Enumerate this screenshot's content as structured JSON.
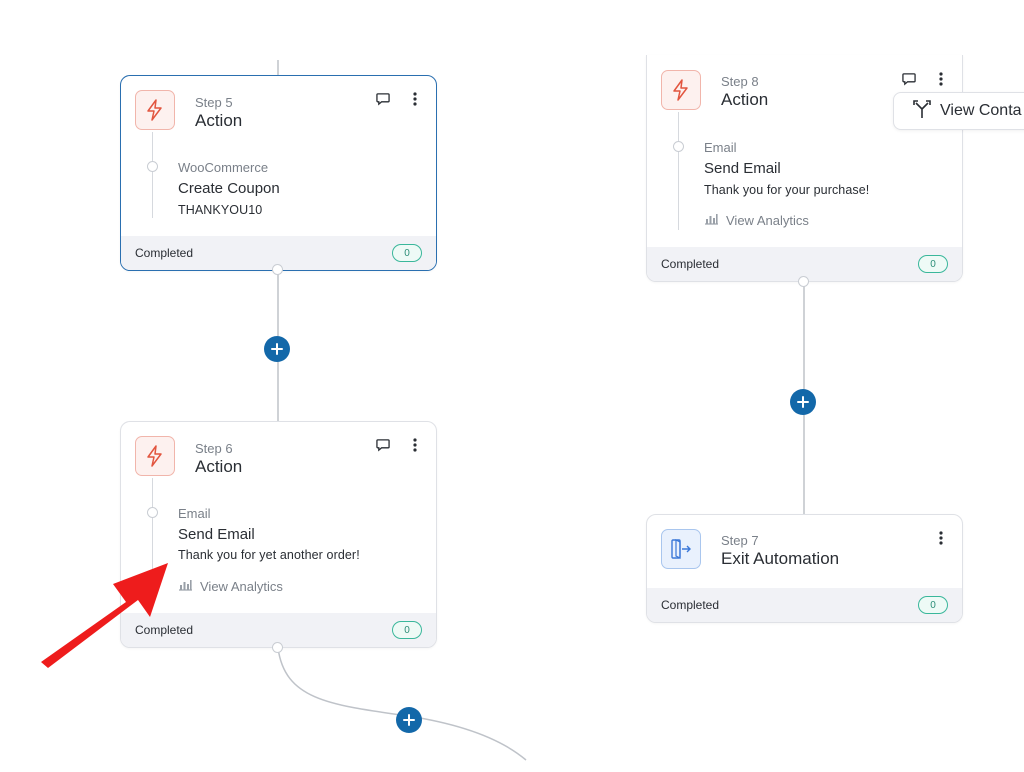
{
  "cards": {
    "step5": {
      "step_label": "Step 5",
      "title": "Action",
      "sub_type": "WooCommerce",
      "sub_title": "Create Coupon",
      "sub_desc": "THANKYOU10",
      "status": "Completed",
      "count": "0"
    },
    "step6": {
      "step_label": "Step 6",
      "title": "Action",
      "sub_type": "Email",
      "sub_title": "Send Email",
      "sub_desc": "Thank you for yet another order!",
      "analytics_label": "View Analytics",
      "status": "Completed",
      "count": "0"
    },
    "step8": {
      "step_label": "Step 8",
      "title": "Action",
      "sub_type": "Email",
      "sub_title": "Send Email",
      "sub_desc": "Thank you for your purchase!",
      "analytics_label": "View Analytics",
      "status": "Completed",
      "count": "0"
    },
    "step7": {
      "step_label": "Step 7",
      "title": "Exit Automation",
      "status": "Completed",
      "count": "0"
    }
  },
  "view_contacts_label": "View Conta",
  "icons": {
    "action": "lightning-bolt-icon",
    "exit": "exit-door-icon",
    "note": "comment-icon",
    "menu": "more-vertical-icon",
    "add": "plus-icon",
    "analytics": "bar-chart-icon",
    "split": "split-path-icon"
  },
  "colors": {
    "accent_blue": "#1368a9",
    "selected_border": "#2a6fb0",
    "action_icon": "#e2553f",
    "exit_icon": "#3b78d8",
    "badge_green": "#3ab79b",
    "annotation_arrow": "#ee1c1c"
  }
}
